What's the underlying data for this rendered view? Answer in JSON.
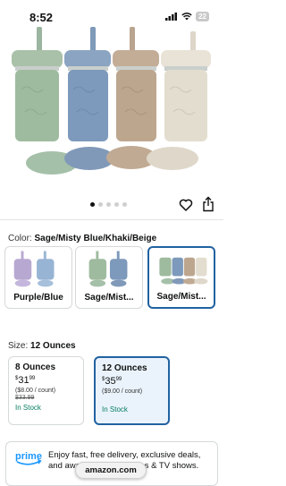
{
  "status": {
    "time": "8:52",
    "battery": "22"
  },
  "carousel": {
    "dots": 5,
    "active_index": 0
  },
  "color": {
    "label": "Color:",
    "selected": "Sage/Misty Blue/Khaki/Beige",
    "options": [
      {
        "label": "Purple/Blue"
      },
      {
        "label": "Sage/Mist..."
      },
      {
        "label": "Sage/Mist..."
      }
    ]
  },
  "size": {
    "label": "Size:",
    "selected": "12 Ounces",
    "options": [
      {
        "title": "8 Ounces",
        "price_whole": "31",
        "price_frac": "99",
        "per_count": "($8.00 / count)",
        "list_price": "$33.99",
        "stock": "In Stock"
      },
      {
        "title": "12 Ounces",
        "price_whole": "35",
        "price_frac": "99",
        "per_count": "($9.00 / count)",
        "stock": "In Stock"
      }
    ]
  },
  "prime": {
    "logo_text": "prime",
    "text": "Enjoy fast, free delivery, exclusive deals, and award-winning movies & TV shows."
  },
  "browser": {
    "url": "amazon.com"
  },
  "colors": {
    "link_blue": "#2162a1",
    "stock_green": "#067d62",
    "prime_blue": "#1a98ff"
  }
}
